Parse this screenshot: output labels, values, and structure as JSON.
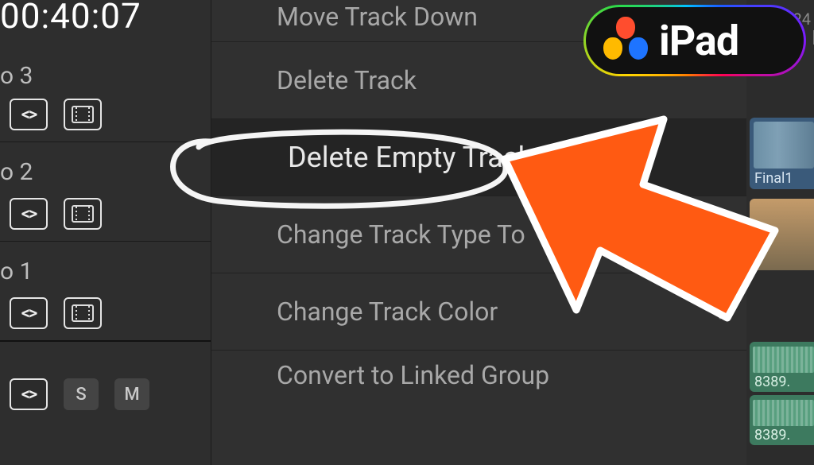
{
  "timecode": "00:40:07",
  "tracks": [
    {
      "label": "o 3",
      "type": "video"
    },
    {
      "label": "o 2",
      "type": "video"
    },
    {
      "label": "o 1",
      "type": "video"
    },
    {
      "label": "",
      "type": "audio",
      "solo": "S",
      "mute": "M"
    }
  ],
  "menu": {
    "items": [
      {
        "label": "Move Track Down",
        "highlighted": false,
        "submenu": false
      },
      {
        "label": "Delete Track",
        "highlighted": false,
        "submenu": false
      },
      {
        "label": "Delete Empty Tracks",
        "highlighted": true,
        "submenu": false
      },
      {
        "label": "Change Track Type To",
        "highlighted": false,
        "submenu": true
      },
      {
        "label": "Change Track Color",
        "highlighted": false,
        "submenu": true
      },
      {
        "label": "Convert to Linked Group",
        "highlighted": false,
        "submenu": false
      }
    ]
  },
  "right_strip": {
    "time_label": "00:24",
    "clip_blue_label": "Final1",
    "clip_green1_label": "8389.",
    "clip_green2_label": "8389."
  },
  "badge": {
    "text": "iPad"
  }
}
